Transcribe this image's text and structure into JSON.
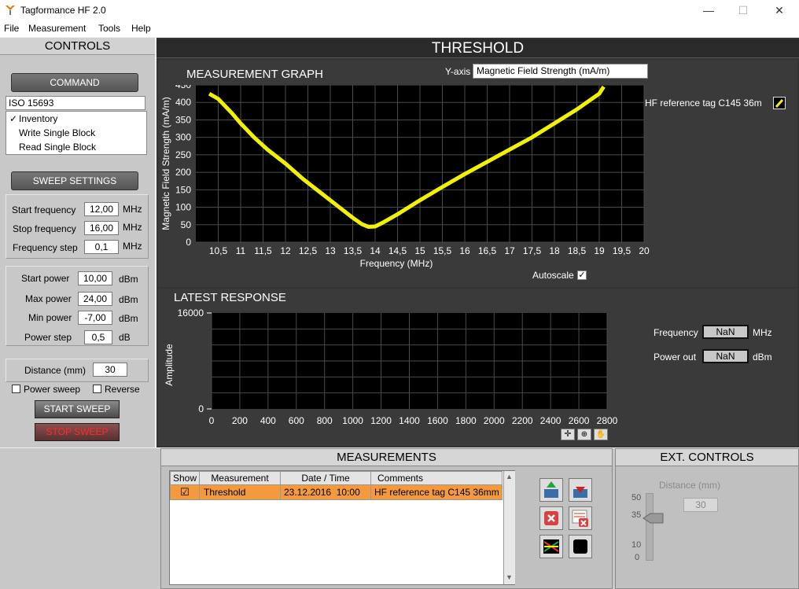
{
  "window": {
    "title": "Tagformance HF  2.0",
    "min": "—",
    "max": "☐",
    "close": "✕"
  },
  "menu": [
    "File",
    "Measurement",
    "Tools",
    "Help"
  ],
  "controls": {
    "header": "CONTROLS",
    "command_label": "COMMAND",
    "protocol": "ISO 15693",
    "commands": [
      {
        "label": "Inventory",
        "checked": "✓"
      },
      {
        "label": "Write Single Block",
        "checked": ""
      },
      {
        "label": "Read Single Block",
        "checked": ""
      }
    ],
    "sweep_label": "SWEEP SETTINGS",
    "start_freq": {
      "label": "Start frequency",
      "value": "12,00",
      "unit": "MHz"
    },
    "stop_freq": {
      "label": "Stop frequency",
      "value": "16,00",
      "unit": "MHz"
    },
    "freq_step": {
      "label": "Frequency step",
      "value": "0,1",
      "unit": "MHz"
    },
    "start_power": {
      "label": "Start power",
      "value": "10,00",
      "unit": "dBm"
    },
    "max_power": {
      "label": "Max power",
      "value": "24,00",
      "unit": "dBm"
    },
    "min_power": {
      "label": "Min power",
      "value": "-7,00",
      "unit": "dBm"
    },
    "power_step": {
      "label": "Power step",
      "value": "0,5",
      "unit": "dB"
    },
    "distance": {
      "label": "Distance (mm)",
      "value": "30"
    },
    "power_sweep": "Power sweep",
    "reverse": "Reverse",
    "start_sweep": "START SWEEP",
    "stop_sweep": "STOP SWEEP"
  },
  "main": {
    "title": "THRESHOLD",
    "graph_title": "MEASUREMENT GRAPH",
    "yaxis_label": "Y-axis",
    "yaxis_value": "Magnetic Field Strength (mA/m)",
    "legend": "HF reference tag C145 36m",
    "autoscale": "Autoscale",
    "latest_title": "LATEST RESPONSE",
    "frequency_label": "Frequency",
    "frequency_value": "NaN",
    "frequency_unit": "MHz",
    "powerout_label": "Power out",
    "powerout_value": "NaN",
    "powerout_unit": "dBm"
  },
  "chart_data": [
    {
      "type": "line",
      "title": "",
      "xlabel": "Frequency (MHz)",
      "ylabel": "Magnetic Field Strength (mA/m)",
      "xlim": [
        10,
        20
      ],
      "ylim": [
        0,
        450
      ],
      "xticks": [
        "10,5",
        "11",
        "11,5",
        "12",
        "12,5",
        "13",
        "13,5",
        "14",
        "14,5",
        "15",
        "15,5",
        "16",
        "16,5",
        "17",
        "17,5",
        "18",
        "18,5",
        "19",
        "19,5",
        "20"
      ],
      "yticks": [
        "0",
        "50",
        "100",
        "150",
        "200",
        "250",
        "300",
        "350",
        "400",
        "450"
      ],
      "grid": true,
      "series": [
        {
          "name": "HF reference tag C145 36m",
          "color": "#f2f200",
          "x": [
            10.3,
            10.5,
            10.8,
            11.0,
            11.3,
            11.6,
            12.0,
            12.4,
            12.8,
            13.2,
            13.5,
            13.7,
            13.85,
            14.0,
            14.2,
            14.5,
            15.0,
            15.5,
            16.0,
            16.5,
            17.0,
            17.5,
            18.0,
            18.5,
            19.0,
            19.1
          ],
          "y": [
            425,
            410,
            370,
            340,
            300,
            265,
            225,
            180,
            140,
            100,
            70,
            52,
            44,
            45,
            58,
            80,
            120,
            158,
            195,
            230,
            265,
            300,
            340,
            380,
            425,
            445
          ]
        }
      ]
    },
    {
      "type": "line",
      "title": "",
      "xlabel": "",
      "ylabel": "Amplitude",
      "xlim": [
        0,
        2800
      ],
      "ylim": [
        0,
        16000
      ],
      "xticks": [
        "0",
        "200",
        "400",
        "600",
        "800",
        "1000",
        "1200",
        "1400",
        "1600",
        "1800",
        "2000",
        "2200",
        "2400",
        "2600",
        "2800"
      ],
      "yticks": [
        "0",
        "16000"
      ],
      "grid": true,
      "series": []
    }
  ],
  "measurements": {
    "header": "MEASUREMENTS",
    "columns": [
      "Show",
      "Measurement",
      "Date / Time",
      "Comments"
    ],
    "rows": [
      {
        "show": "☑",
        "measurement": "Threshold",
        "datetime": "23.12.2016  10:00",
        "comments": "HF reference tag C145 36mm"
      }
    ]
  },
  "ext": {
    "header": "EXT. CONTROLS",
    "distance_label": "Distance (mm)",
    "distance_value": "30",
    "slider_ticks": [
      "50",
      "35",
      "10",
      "0"
    ],
    "slider_level": 35
  }
}
